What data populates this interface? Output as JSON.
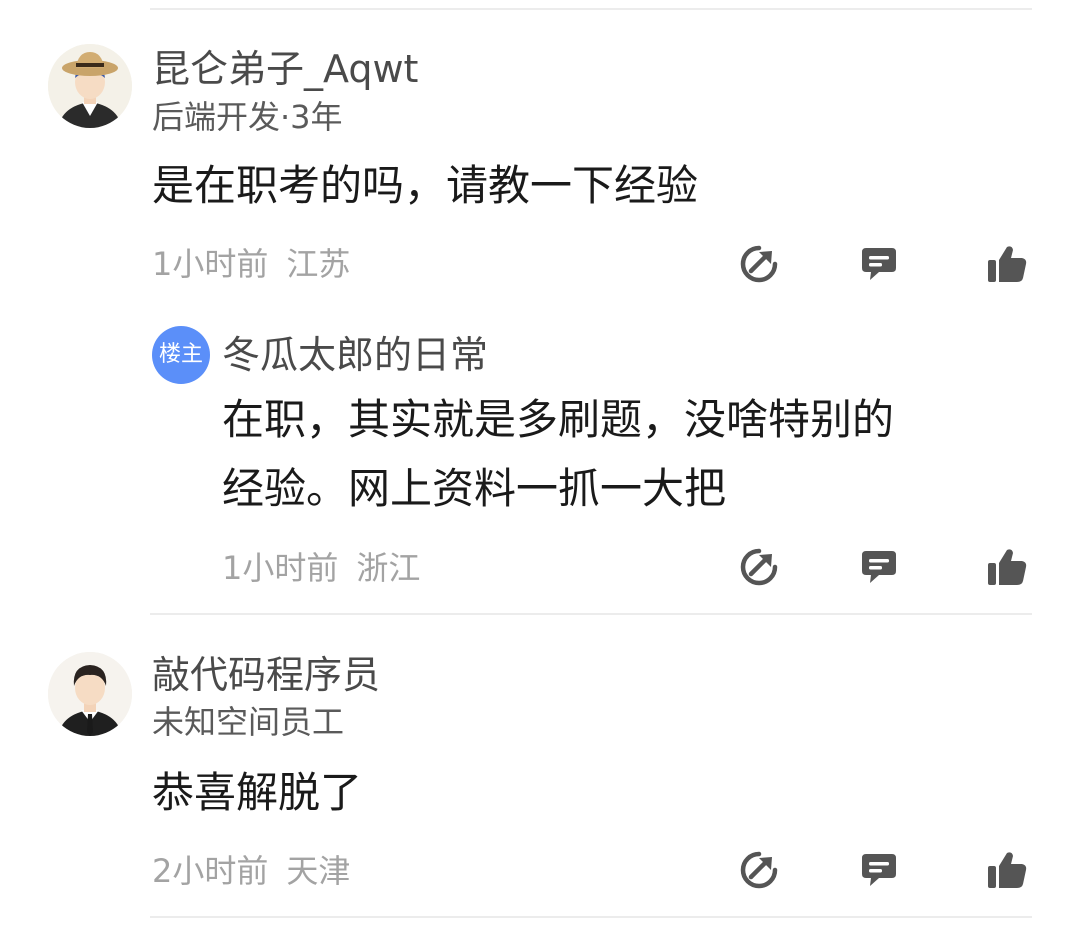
{
  "comments": [
    {
      "username": "昆仑弟子_Aqwt",
      "subtitle": "后端开发·3年",
      "text": "是在职考的吗，请教一下经验",
      "time": "1小时前",
      "location": "江苏"
    },
    {
      "badge": "楼主",
      "username": "冬瓜太郎的日常",
      "text_line1": "在职，其实就是多刷题，没啥特别的",
      "text_line2": "经验。网上资料一抓一大把",
      "time": "1小时前",
      "location": "浙江"
    },
    {
      "username": "敲代码程序员",
      "subtitle": "未知空间员工",
      "text": "恭喜解脱了",
      "time": "2小时前",
      "location": "天津"
    }
  ],
  "icons": {
    "share": "share-icon",
    "reply": "comment-icon",
    "like": "thumbs-up-icon"
  },
  "colors": {
    "icon": "#555555",
    "badge": "#5b8ff9",
    "meta": "#a3a3a3"
  }
}
